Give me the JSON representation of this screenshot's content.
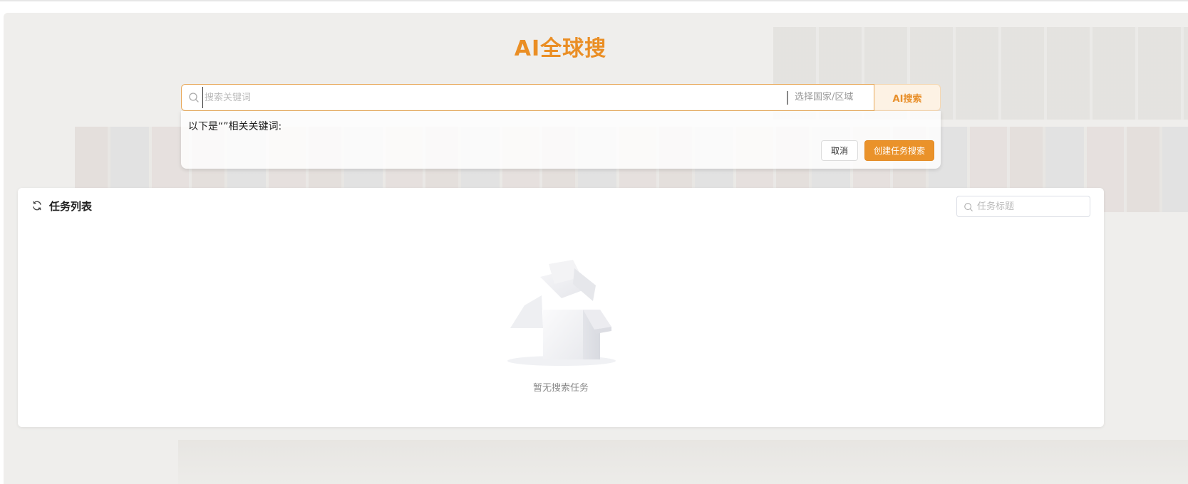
{
  "page": {
    "title": "AI全球搜"
  },
  "search": {
    "placeholder": "搜索关键词",
    "value": "",
    "region_placeholder": "选择国家/区域",
    "button_label": "AI搜索"
  },
  "keyword_panel": {
    "text": "以下是“”相关关键词:",
    "cancel_label": "取消",
    "create_label": "创建任务搜索"
  },
  "task_list": {
    "title": "任务列表",
    "search_placeholder": "任务标题",
    "empty_text": "暂无搜索任务"
  },
  "colors": {
    "accent": "#ea922a",
    "title": "#ea8e24",
    "ai_button_bg": "#fdf2e4"
  },
  "icons": {
    "search": "search-icon",
    "refresh": "refresh-icon",
    "empty": "empty-box-icon"
  }
}
